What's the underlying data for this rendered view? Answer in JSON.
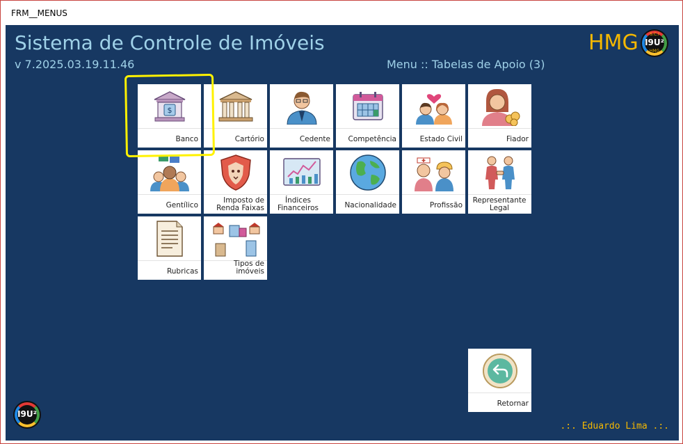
{
  "window": {
    "title": "FRM__MENUS"
  },
  "header": {
    "app_title": "Sistema de Controle de Imóveis",
    "version": "v 7.2025.03.19.11.46",
    "menu_title": "Menu :: Tabelas de Apoio (3)",
    "brand": "HMG",
    "logo_text": "I9U²",
    "logo_sub_top": "S.C.I",
    "logo_sub_bottom": "HMG"
  },
  "tiles": [
    {
      "label": "Banco",
      "icon": "bank-icon"
    },
    {
      "label": "Cartório",
      "icon": "courthouse-icon"
    },
    {
      "label": "Cedente",
      "icon": "businessman-icon"
    },
    {
      "label": "Competência",
      "icon": "calendar-icon"
    },
    {
      "label": "Estado Civil",
      "icon": "couple-heart-icon"
    },
    {
      "label": "Fiador",
      "icon": "woman-coins-icon"
    },
    {
      "label": "Gentílico",
      "icon": "people-flags-icon"
    },
    {
      "label": "Imposto de Renda Faixas",
      "icon": "lion-shield-icon"
    },
    {
      "label": "Índices Financeiros",
      "icon": "chart-board-icon"
    },
    {
      "label": "Nacionalidade",
      "icon": "globe-icon"
    },
    {
      "label": "Profissão",
      "icon": "professionals-icon"
    },
    {
      "label": "Representante Legal",
      "icon": "handshake-icon"
    },
    {
      "label": "Rubricas",
      "icon": "document-icon"
    },
    {
      "label": "Tipos de imóveis",
      "icon": "buildings-icon"
    }
  ],
  "return_button": {
    "label": "Retornar",
    "icon": "return-arrow-icon"
  },
  "footer": {
    "user": ".:. Eduardo Lima .:."
  },
  "colors": {
    "background": "#173862",
    "accent_text": "#9fd1e8",
    "brand": "#f5b800",
    "highlight": "#fff200"
  }
}
